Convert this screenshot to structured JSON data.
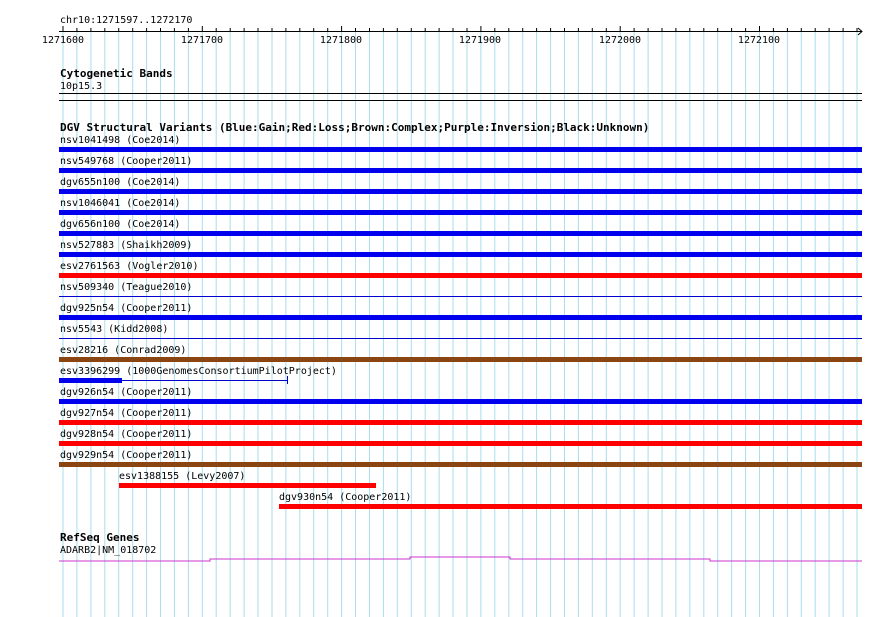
{
  "ruler": {
    "region_label": "chr10:1271597..1272170",
    "ticks": [
      "1271600",
      "1271700",
      "1271800",
      "1271900",
      "1272000",
      "1272100"
    ]
  },
  "cytoband": {
    "title": "Cytogenetic Bands",
    "band": "10p15.3"
  },
  "dgv": {
    "title": "DGV Structural Variants (Blue:Gain;Red:Loss;Brown:Complex;Purple:Inversion;Black:Unknown)",
    "colors": {
      "gain": "#0000ee",
      "loss": "#ff0000",
      "complex": "#8b4513"
    },
    "variants": [
      {
        "label": "nsv1041498 (Coe2014)",
        "type": "gain"
      },
      {
        "label": "nsv549768 (Cooper2011)",
        "type": "gain"
      },
      {
        "label": "dgv655n100 (Coe2014)",
        "type": "gain"
      },
      {
        "label": "nsv1046041 (Coe2014)",
        "type": "gain"
      },
      {
        "label": "dgv656n100 (Coe2014)",
        "type": "gain"
      },
      {
        "label": "nsv527883 (Shaikh2009)",
        "type": "gain"
      },
      {
        "label": "esv2761563 (Vogler2010)",
        "type": "loss"
      },
      {
        "label": "nsv509340 (Teague2010)",
        "type": "gain"
      },
      {
        "label": "dgv925n54 (Cooper2011)",
        "type": "gain"
      },
      {
        "label": "nsv5543 (Kidd2008)",
        "type": "gain"
      },
      {
        "label": "esv28216 (Conrad2009)",
        "type": "complex"
      },
      {
        "label": "esv3396299 (1000GenomesConsortiumPilotProject)",
        "type": "gain"
      },
      {
        "label": "dgv926n54 (Cooper2011)",
        "type": "gain"
      },
      {
        "label": "dgv927n54 (Cooper2011)",
        "type": "loss"
      },
      {
        "label": "dgv928n54 (Cooper2011)",
        "type": "loss"
      },
      {
        "label": "dgv929n54 (Cooper2011)",
        "type": "complex"
      },
      {
        "label": "esv1388155 (Levy2007)",
        "type": "loss"
      },
      {
        "label": "dgv930n54 (Cooper2011)",
        "type": "loss"
      }
    ]
  },
  "refseq": {
    "title": "RefSeq Genes",
    "gene_label": "ADARB2|NM_018702",
    "color": "#cc33cc"
  },
  "grid_color": "#aaddee"
}
